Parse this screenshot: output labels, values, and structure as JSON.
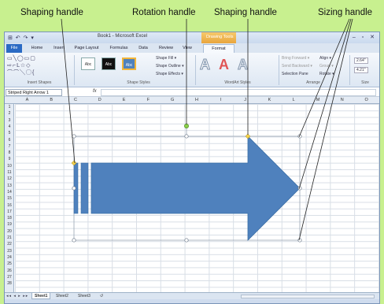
{
  "annotations": {
    "shaping_left": "Shaping handle",
    "rotation": "Rotation handle",
    "shaping_right": "Shaping handle",
    "sizing": "Sizing handle"
  },
  "window": {
    "title": "Book1 - Microsoft Excel",
    "context_tab": "Drawing Tools",
    "quick_access": "⊞ ↶ ↷ ▾",
    "window_controls": "– ▫ ✕"
  },
  "tabs": [
    "File",
    "Home",
    "Insert",
    "Page Layout",
    "Formulas",
    "Data",
    "Review",
    "View",
    "Format"
  ],
  "ribbon": {
    "insert_shapes_label": "Insert Shapes",
    "shape_styles_label": "Shape Styles",
    "wordart_label": "WordArt Styles",
    "arrange_label": "Arrange",
    "size_label": "Size",
    "style_boxes": [
      "Abc",
      "Abc",
      "Abc"
    ],
    "shape_fill": "Shape Fill ▾",
    "shape_outline": "Shape Outline ▾",
    "shape_effects": "Shape Effects ▾",
    "bring_forward": "Bring Forward ▾",
    "send_backward": "Send Backward ▾",
    "selection_pane": "Selection Pane",
    "align": "Align ▾",
    "group": "Group ▾",
    "rotate": "Rotate ▾",
    "height": "2.64\"",
    "width": "4.21\"",
    "wordart_letter": "A"
  },
  "formula_bar": {
    "name_box": "Striped Right Arrow 1",
    "fx": "fx"
  },
  "columns": [
    "A",
    "B",
    "C",
    "D",
    "E",
    "F",
    "G",
    "H",
    "I",
    "J",
    "K",
    "L",
    "M",
    "N",
    "O"
  ],
  "rows": [
    "1",
    "2",
    "3",
    "4",
    "5",
    "6",
    "7",
    "8",
    "9",
    "10",
    "11",
    "12",
    "13",
    "14",
    "15",
    "16",
    "17",
    "18",
    "19",
    "20",
    "21",
    "22",
    "23",
    "24",
    "25",
    "26",
    "27",
    "28"
  ],
  "sheets": [
    "Sheet1",
    "Sheet2",
    "Sheet3"
  ],
  "sheet_nav": "◂◂ ◂ ▸ ▸▸",
  "colors": {
    "background": "#c8f08f",
    "arrow_fill": "#4f81bd",
    "arrow_stroke": "#3a6ea5",
    "handle_shaping": "#f2d04a",
    "handle_rotation": "#8cd048"
  }
}
